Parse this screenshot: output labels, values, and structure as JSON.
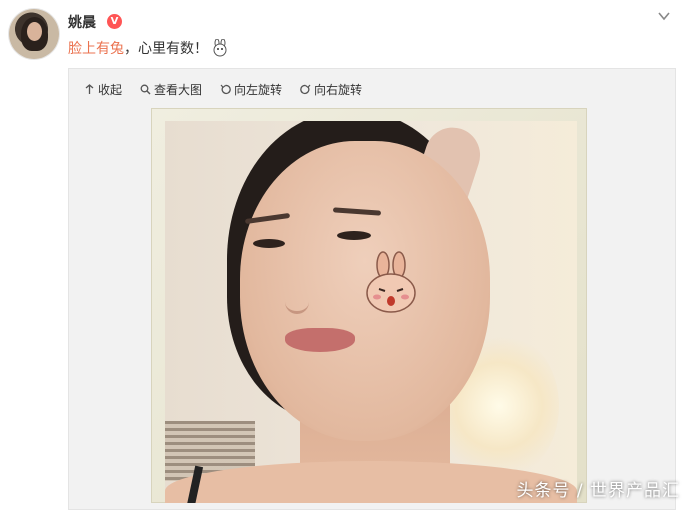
{
  "post": {
    "username": "姚晨",
    "verified_badge": "V",
    "topic": "脸上有兔",
    "text": "，心里有数！"
  },
  "toolbar": {
    "collapse": "收起",
    "view_large": "查看大图",
    "rotate_left": "向左旋转",
    "rotate_right": "向右旋转"
  },
  "watermark": "头条号 / 世界产品汇",
  "colors": {
    "topic": "#eb7350",
    "verified": "#ff5555"
  }
}
